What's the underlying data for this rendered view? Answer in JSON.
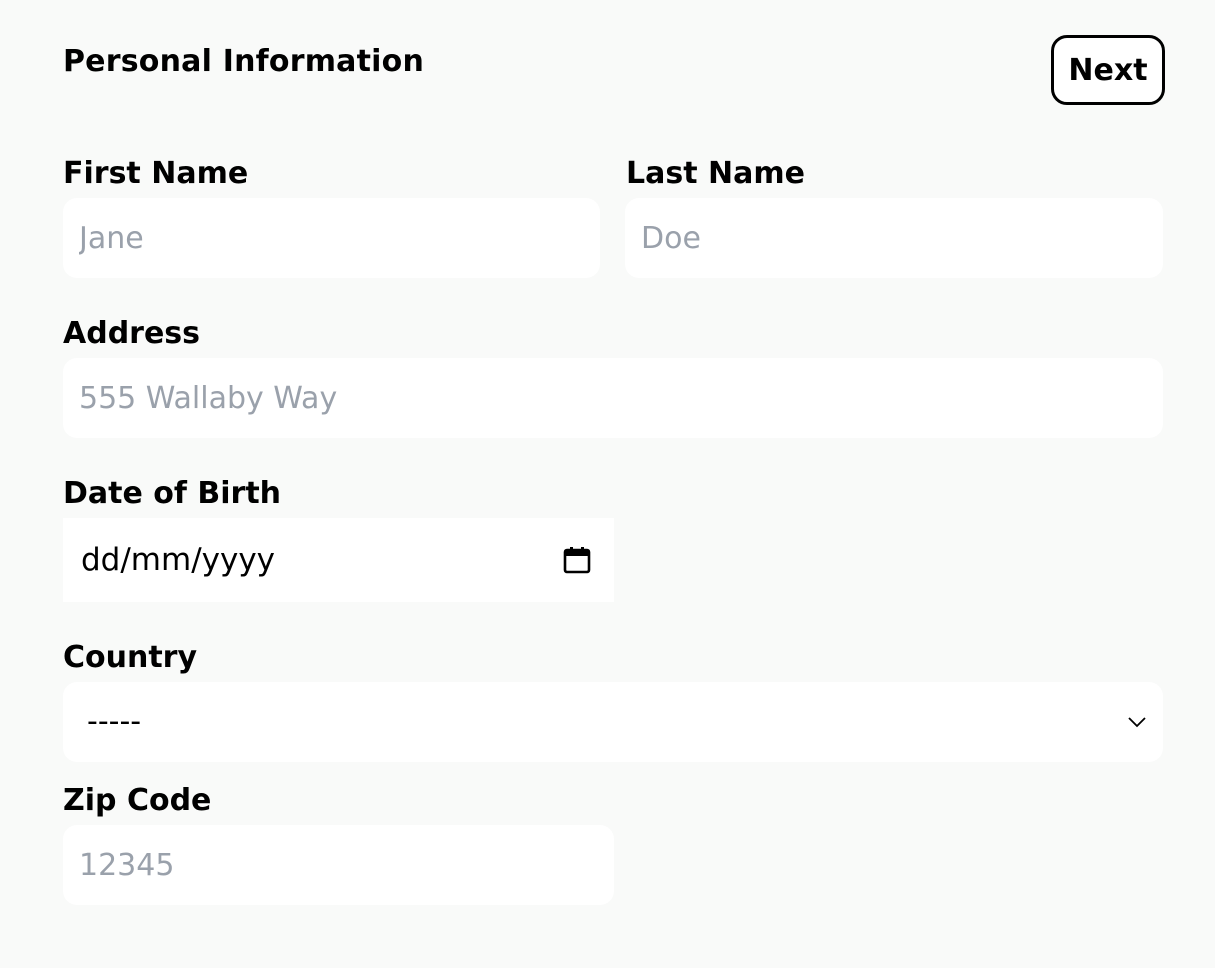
{
  "form": {
    "title": "Personal Information",
    "next_label": "Next"
  },
  "fields": {
    "first_name": {
      "label": "First Name",
      "placeholder": "Jane",
      "value": ""
    },
    "last_name": {
      "label": "Last Name",
      "placeholder": "Doe",
      "value": ""
    },
    "address": {
      "label": "Address",
      "placeholder": "555 Wallaby Way",
      "value": ""
    },
    "date_of_birth": {
      "label": "Date of Birth",
      "display": "dd/mm/yyyy",
      "icon": "calendar-icon"
    },
    "country": {
      "label": "Country",
      "selected": "-----",
      "icon": "chevron-down-icon"
    },
    "zip_code": {
      "label": "Zip Code",
      "placeholder": "12345",
      "value": ""
    }
  },
  "colors": {
    "background": "#f9faf9",
    "field_background": "#ffffff",
    "placeholder": "#9aa1ab",
    "text": "#000000"
  }
}
